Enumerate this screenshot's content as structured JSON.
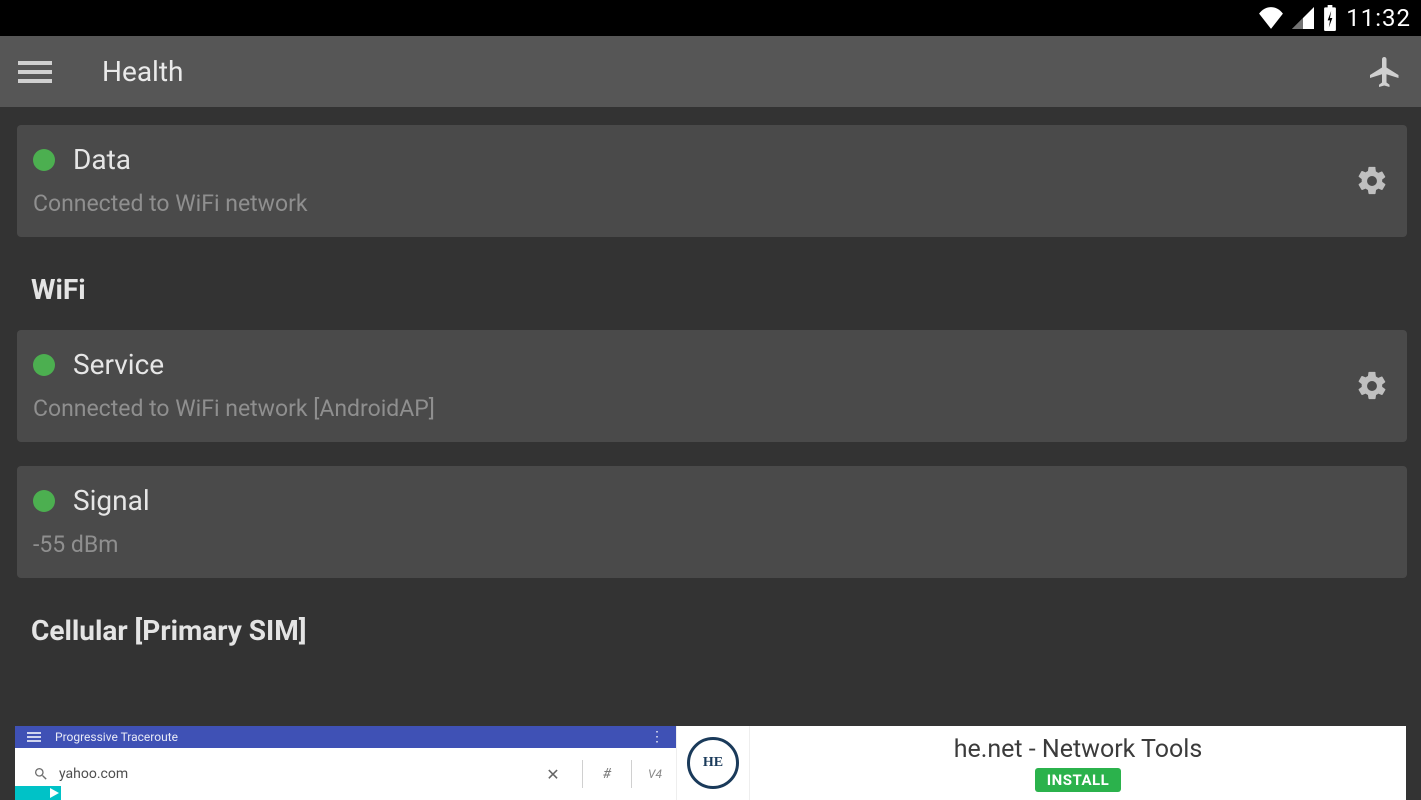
{
  "status_bar": {
    "clock": "11:32"
  },
  "app_bar": {
    "title": "Health"
  },
  "cards": {
    "data": {
      "title": "Data",
      "subtitle": "Connected to WiFi network",
      "status_color": "#4caf50"
    },
    "service": {
      "title": "Service",
      "subtitle": "Connected to WiFi network [AndroidAP]",
      "status_color": "#4caf50"
    },
    "signal": {
      "title": "Signal",
      "subtitle": "-55 dBm",
      "status_color": "#4caf50"
    }
  },
  "sections": {
    "wifi": "WiFi",
    "cellular": "Cellular [Primary SIM]"
  },
  "ad": {
    "mini_title": "Progressive Traceroute",
    "search_text": "yahoo.com",
    "hash": "#",
    "v4": "V4",
    "logo_text": "HE",
    "headline": "he.net - Network Tools",
    "install": "INSTALL"
  }
}
